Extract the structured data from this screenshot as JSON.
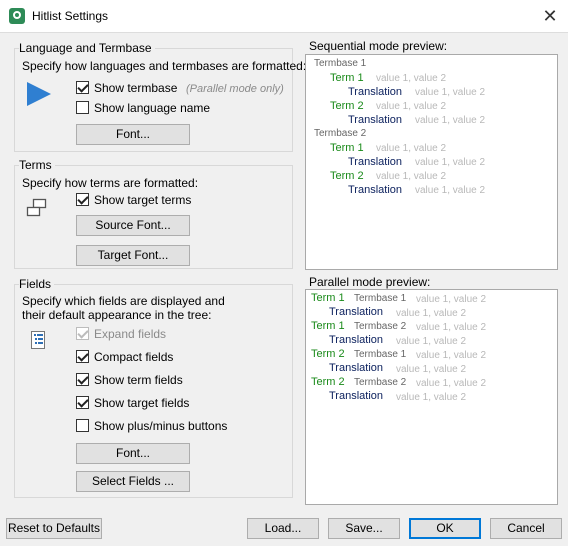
{
  "window": {
    "title": "Hitlist Settings"
  },
  "lang_group": {
    "label": "Language and Termbase",
    "desc": "Specify how languages and termbases are formatted:",
    "show_termbase": "Show termbase",
    "parallel_hint": "(Parallel mode only)",
    "show_language_name": "Show language name",
    "font_button": "Font..."
  },
  "terms_group": {
    "label": "Terms",
    "desc": "Specify how terms are formatted:",
    "show_target_terms": "Show target terms",
    "source_font_button": "Source Font...",
    "target_font_button": "Target Font..."
  },
  "fields_group": {
    "label": "Fields",
    "desc_line1": "Specify which fields are displayed and",
    "desc_line2": "their default appearance in the tree:",
    "expand_fields": "Expand fields",
    "compact_fields": "Compact fields",
    "show_term_fields": "Show term fields",
    "show_target_fields": "Show target fields",
    "show_plus_minus": "Show plus/minus buttons",
    "font_button": "Font...",
    "select_fields_button": "Select Fields ..."
  },
  "sequential_preview": {
    "label": "Sequential mode preview:",
    "tb1": "Termbase 1",
    "tb2": "Termbase 2",
    "term1": "Term 1",
    "term2": "Term 2",
    "translation": "Translation",
    "values": "value 1, value 2"
  },
  "parallel_preview": {
    "label": "Parallel mode preview:",
    "term1": "Term 1",
    "term2": "Term 2",
    "tb1": "Termbase 1",
    "tb2": "Termbase 2",
    "translation": "Translation",
    "values": "value 1, value 2"
  },
  "footer": {
    "reset": "Reset to Defaults",
    "load": "Load...",
    "save": "Save...",
    "ok": "OK",
    "cancel": "Cancel"
  },
  "colors": {
    "term_green": "#1a8a1a",
    "translation_navy": "#0a1f5c",
    "accent_blue": "#0078d7"
  }
}
